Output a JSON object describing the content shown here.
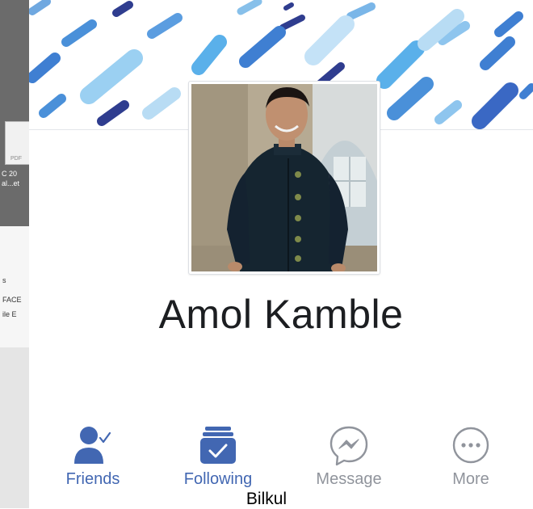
{
  "desktop": {
    "pdf_label": "PDF",
    "file_lines": [
      "C 20",
      "al...et"
    ],
    "window_lines": [
      "s",
      "FACE",
      "ile E"
    ]
  },
  "profile": {
    "name": "Amol Kamble"
  },
  "actions": [
    {
      "label": "Friends",
      "icon": "friends-check-icon"
    },
    {
      "label": "Following",
      "icon": "following-icon"
    },
    {
      "label": "Message",
      "icon": "messenger-icon"
    },
    {
      "label": "More",
      "icon": "more-icon"
    }
  ],
  "colors": {
    "accent": "#4267b2",
    "muted": "#90949c",
    "name_text": "#1c1e21"
  },
  "caption": "Bilkul"
}
